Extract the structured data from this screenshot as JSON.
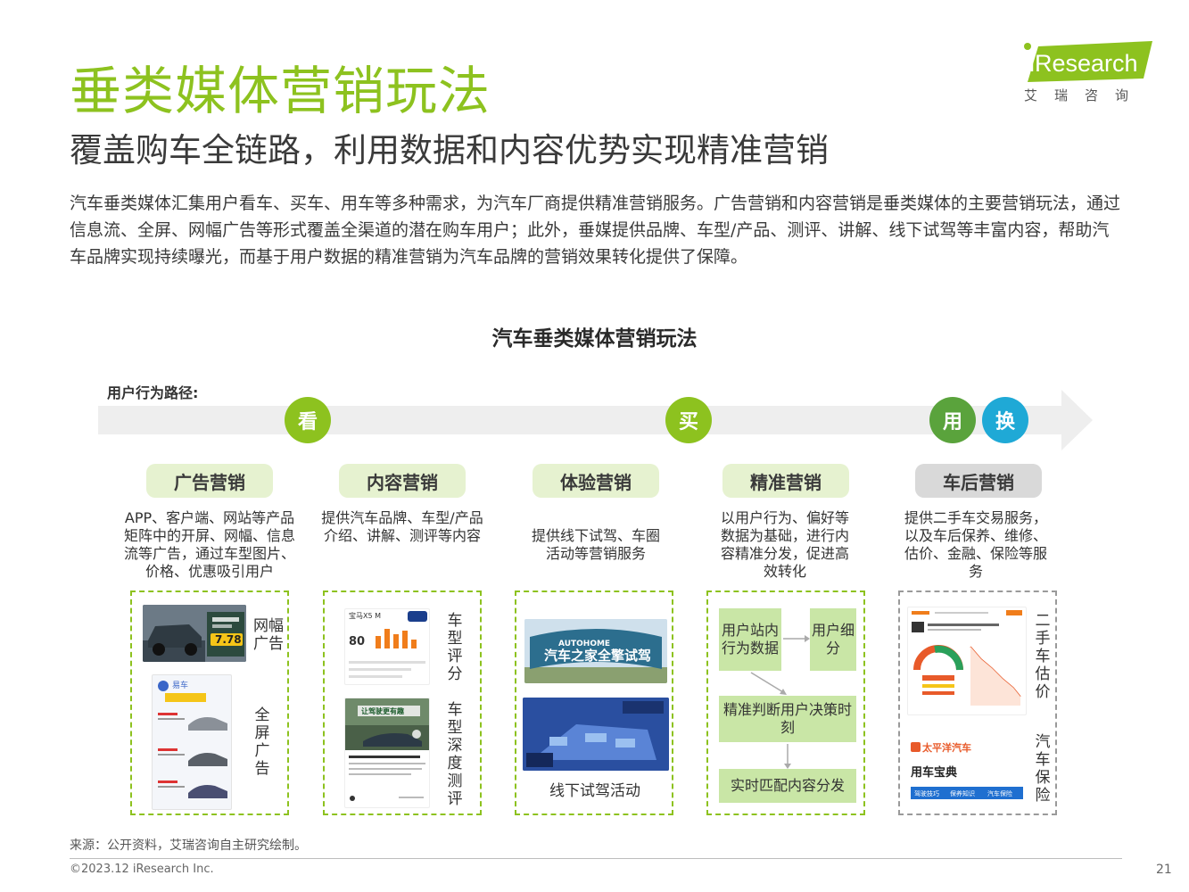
{
  "header": {
    "title": "垂类媒体营销玩法",
    "subtitle": "覆盖购车全链路，利用数据和内容优势实现精准营销",
    "intro": "汽车垂类媒体汇集用户看车、买车、用车等多种需求，为汽车厂商提供精准营销服务。广告营销和内容营销是垂类媒体的主要营销玩法，通过信息流、全屏、网幅广告等形式覆盖全渠道的潜在购车用户；此外，垂媒提供品牌、车型/产品、测评、讲解、线下试驾等丰富内容，帮助汽车品牌实现持续曝光，而基于用户数据的精准营销为汽车品牌的营销效果转化提供了保障。"
  },
  "logo": {
    "text": "iResearch",
    "sub": "艾瑞咨询"
  },
  "diagram": {
    "title": "汽车垂类媒体营销玩法",
    "path_label": "用户行为路径:",
    "stages": [
      {
        "label": "看",
        "color": "#8dc21f"
      },
      {
        "label": "买",
        "color": "#8dc21f"
      },
      {
        "label": "用",
        "color": "#5aa33c"
      },
      {
        "label": "换",
        "color": "#1fa9d6"
      }
    ],
    "columns": [
      {
        "pill": "广告营销",
        "pill_color": "#e6f2d0",
        "desc": "APP、客户端、网站等产品矩阵中的开屏、网幅、信息流等广告，通过车型图片、价格、优惠吸引用户",
        "labels": [
          "网幅广告",
          "全屏广告"
        ],
        "shot_text": {
          "price": "7.78",
          "brand": "易车"
        }
      },
      {
        "pill": "内容营销",
        "pill_color": "#e6f2d0",
        "desc": "提供汽车品牌、车型/产品介绍、讲解、测评等内容",
        "labels": [
          "车型评分",
          "车型深度测评"
        ],
        "shot_text": {
          "score": "80",
          "model": "宝马X5 M",
          "banner": "让驾驶更有趣"
        }
      },
      {
        "pill": "体验营销",
        "pill_color": "#e6f2d0",
        "desc": "提供线下试驾、车圈活动等营销服务",
        "labels": [
          "线下试驾活动"
        ],
        "shot_text": {
          "en": "AUTOHOME",
          "cn": "汽车之家全擎试驾"
        }
      },
      {
        "pill": "精准营销",
        "pill_color": "#e6f2d0",
        "desc": "以用户行为、偏好等数据为基础，进行内容精准分发，促进高效转化",
        "flow": [
          "用户站内行为数据",
          "用户细分",
          "精准判断用户决策时刻",
          "实时匹配内容分发"
        ]
      },
      {
        "pill": "车后营销",
        "pill_color": "#d9d9d9",
        "desc": "提供二手车交易服务，以及车后保养、维修、估价、金融、保险等服务",
        "labels": [
          "二手车估价",
          "汽车保险"
        ],
        "shot_text": {
          "brand": "太平洋汽车",
          "title": "用车宝典",
          "tabs": [
            "驾驶技巧",
            "保养知识",
            "汽车保险"
          ]
        }
      }
    ]
  },
  "footer": {
    "source": "来源：公开资料，艾瑞咨询自主研究绘制。",
    "copyright": "©2023.12 iResearch Inc.",
    "page": "21"
  },
  "colors": {
    "brand_green": "#8dc21f",
    "light_green": "#c9e6a6",
    "blue": "#1fa9d6"
  }
}
